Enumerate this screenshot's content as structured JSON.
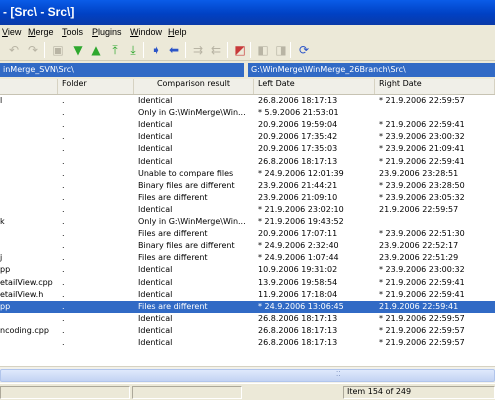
{
  "window": {
    "title": "- [Src\\ - Src\\]"
  },
  "menu": [
    "View",
    "Merge",
    "Tools",
    "Plugins",
    "Window",
    "Help"
  ],
  "toolbar": {
    "buttons": [
      {
        "name": "undo-icon",
        "glyph": "↶",
        "enabled": false
      },
      {
        "name": "redo-icon",
        "glyph": "↷",
        "enabled": false
      },
      {
        "name": "save-icon",
        "glyph": "▣",
        "enabled": false
      },
      {
        "name": "next-diff-icon",
        "glyph": "▼",
        "enabled": true,
        "color": "#2ea82e"
      },
      {
        "name": "prev-diff-icon",
        "glyph": "▲",
        "enabled": true,
        "color": "#2ea82e"
      },
      {
        "name": "first-diff-icon",
        "glyph": "⤒",
        "enabled": true,
        "color": "#2ea82e"
      },
      {
        "name": "last-diff-icon",
        "glyph": "⤓",
        "enabled": true,
        "color": "#2ea82e"
      },
      {
        "name": "copy-right-icon",
        "glyph": "➧",
        "enabled": true,
        "color": "#2c55c8"
      },
      {
        "name": "copy-left-icon",
        "glyph": "⬅",
        "enabled": true,
        "color": "#2c55c8"
      },
      {
        "name": "copy-all-right-icon",
        "glyph": "⇉",
        "enabled": false
      },
      {
        "name": "copy-all-left-icon",
        "glyph": "⇇",
        "enabled": false
      },
      {
        "name": "options-icon",
        "glyph": "◩",
        "enabled": true,
        "color": "#c83a3a"
      },
      {
        "name": "left-only-icon",
        "glyph": "◧",
        "enabled": false
      },
      {
        "name": "right-only-icon",
        "glyph": "◨",
        "enabled": false
      },
      {
        "name": "refresh-icon",
        "glyph": "⟳",
        "enabled": true,
        "color": "#2c55c8"
      }
    ]
  },
  "paths": {
    "left": "inMerge_SVN\\Src\\",
    "right": "G:\\WinMerge\\WinMerge_26Branch\\Src\\"
  },
  "columns": [
    "Folder",
    "Comparison result",
    "Left Date",
    "Right Date"
  ],
  "rows": [
    {
      "name": "l",
      "folder": ".",
      "result": "Identical",
      "left": "26.8.2006 18:17:13",
      "right": "* 21.9.2006 22:59:57"
    },
    {
      "name": "",
      "folder": ".",
      "result": "Only in G:\\WinMerge\\Win...",
      "left": "* 5.9.2006 21:53:01",
      "right": ""
    },
    {
      "name": "",
      "folder": ".",
      "result": "Identical",
      "left": "20.9.2006 19:59:04",
      "right": "* 21.9.2006 22:59:41"
    },
    {
      "name": "",
      "folder": ".",
      "result": "Identical",
      "left": "20.9.2006 17:35:42",
      "right": "* 23.9.2006 23:00:32"
    },
    {
      "name": "",
      "folder": ".",
      "result": "Identical",
      "left": "20.9.2006 17:35:03",
      "right": "* 23.9.2006 21:09:41"
    },
    {
      "name": "",
      "folder": ".",
      "result": "Identical",
      "left": "26.8.2006 18:17:13",
      "right": "* 21.9.2006 22:59:41"
    },
    {
      "name": "",
      "folder": ".",
      "result": "Unable to compare files",
      "left": "* 24.9.2006 12:01:39",
      "right": "23.9.2006 23:28:51"
    },
    {
      "name": "",
      "folder": ".",
      "result": "Binary files are different",
      "left": "23.9.2006 21:44:21",
      "right": "* 23.9.2006 23:28:50"
    },
    {
      "name": "",
      "folder": ".",
      "result": "Files are different",
      "left": "23.9.2006 21:09:10",
      "right": "* 23.9.2006 23:05:32"
    },
    {
      "name": "",
      "folder": ".",
      "result": "Identical",
      "left": "* 21.9.2006 23:02:10",
      "right": "21.9.2006 22:59:57"
    },
    {
      "name": "k",
      "folder": ".",
      "result": "Only in G:\\WinMerge\\Win...",
      "left": "* 21.9.2006 19:43:52",
      "right": ""
    },
    {
      "name": "",
      "folder": ".",
      "result": "Files are different",
      "left": "20.9.2006 17:07:11",
      "right": "* 23.9.2006 22:51:30"
    },
    {
      "name": "",
      "folder": ".",
      "result": "Binary files are different",
      "left": "* 24.9.2006 2:32:40",
      "right": "23.9.2006 22:52:17"
    },
    {
      "name": "j",
      "folder": ".",
      "result": "Files are different",
      "left": "* 24.9.2006 1:07:44",
      "right": "23.9.2006 22:51:29"
    },
    {
      "name": "pp",
      "folder": ".",
      "result": "Identical",
      "left": "10.9.2006 19:31:02",
      "right": "* 23.9.2006 23:00:32"
    },
    {
      "name": "etailView.cpp",
      "folder": ".",
      "result": "Identical",
      "left": "13.9.2006 19:58:54",
      "right": "* 21.9.2006 22:59:41"
    },
    {
      "name": "etailView.h",
      "folder": ".",
      "result": "Identical",
      "left": "11.9.2006 17:18:04",
      "right": "* 21.9.2006 22:59:41"
    },
    {
      "name": "pp",
      "folder": ".",
      "result": "Files are different",
      "left": "* 24.9.2006 13:06:45",
      "right": "21.9.2006 22:59:41",
      "selected": true
    },
    {
      "name": "",
      "folder": ".",
      "result": "Identical",
      "left": "26.8.2006 18:17:13",
      "right": "* 21.9.2006 22:59:57"
    },
    {
      "name": "ncoding.cpp",
      "folder": ".",
      "result": "Identical",
      "left": "26.8.2006 18:17:13",
      "right": "* 21.9.2006 22:59:57"
    },
    {
      "name": "",
      "folder": ".",
      "result": "Identical",
      "left": "26.8.2006 18:17:13",
      "right": "* 21.9.2006 22:59:57"
    }
  ],
  "status": {
    "item": "Item 154 of 249"
  },
  "colors": {
    "selection": "#316ac5",
    "path_bar": "#316ac5",
    "title_bar": "#0041c4"
  }
}
